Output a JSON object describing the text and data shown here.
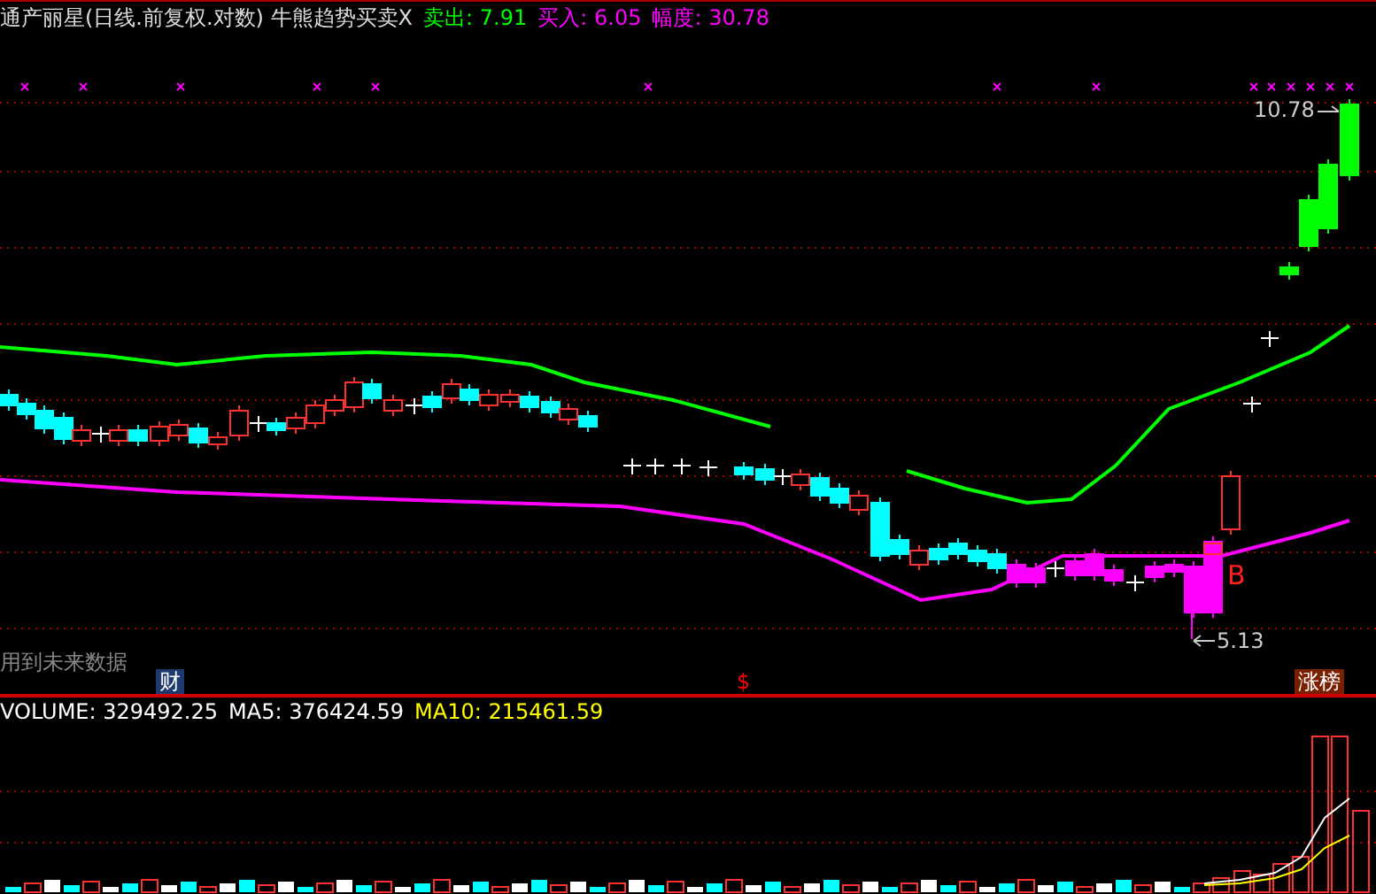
{
  "header": {
    "title": "通产丽星(日线.前复权.对数) 牛熊趋势买卖X",
    "readings": [
      {
        "label": "卖出:",
        "value": "7.91",
        "color": "#00ff00"
      },
      {
        "label": "买入:",
        "value": "6.05",
        "color": "#ff00ff"
      },
      {
        "label": "幅度:",
        "value": "30.78",
        "color": "#ff00ff"
      }
    ]
  },
  "price_chart": {
    "high_label": "10.78",
    "low_label": "5.13",
    "signal": "B",
    "notice": "用到未来数据",
    "markers": [
      {
        "kind": "finance",
        "text": "财"
      },
      {
        "kind": "dollar",
        "text": "$"
      },
      {
        "kind": "limit_up",
        "text": "涨榜"
      }
    ]
  },
  "volume_panel": {
    "readings": [
      {
        "label": "VOLUME:",
        "value": "329492.25",
        "color": "#ffffff"
      },
      {
        "label": "MA5:",
        "value": "376424.59",
        "color": "#ffffff"
      },
      {
        "label": "MA10:",
        "value": "215461.59",
        "color": "#ffff00"
      }
    ]
  }
}
